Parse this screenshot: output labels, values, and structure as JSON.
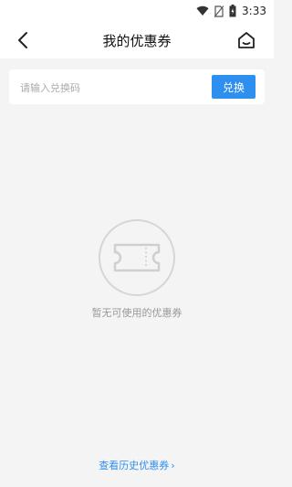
{
  "status_bar": {
    "time": "3:33",
    "icons": [
      "wifi-icon",
      "no-sim-icon",
      "battery-icon"
    ]
  },
  "app_bar": {
    "title": "我的优惠券",
    "back_icon": "back-arrow-icon",
    "home_icon": "home-icon"
  },
  "redeem": {
    "placeholder": "请输入兑换码",
    "value": "",
    "button_label": "兑换"
  },
  "empty_state": {
    "icon": "coupon-ticket-icon",
    "text": "暂无可使用的优惠券"
  },
  "footer": {
    "history_link": "查看历史优惠券",
    "chevron": "›"
  },
  "colors": {
    "accent": "#2f8fee",
    "background": "#f4f4f4",
    "muted_text": "#999999"
  }
}
